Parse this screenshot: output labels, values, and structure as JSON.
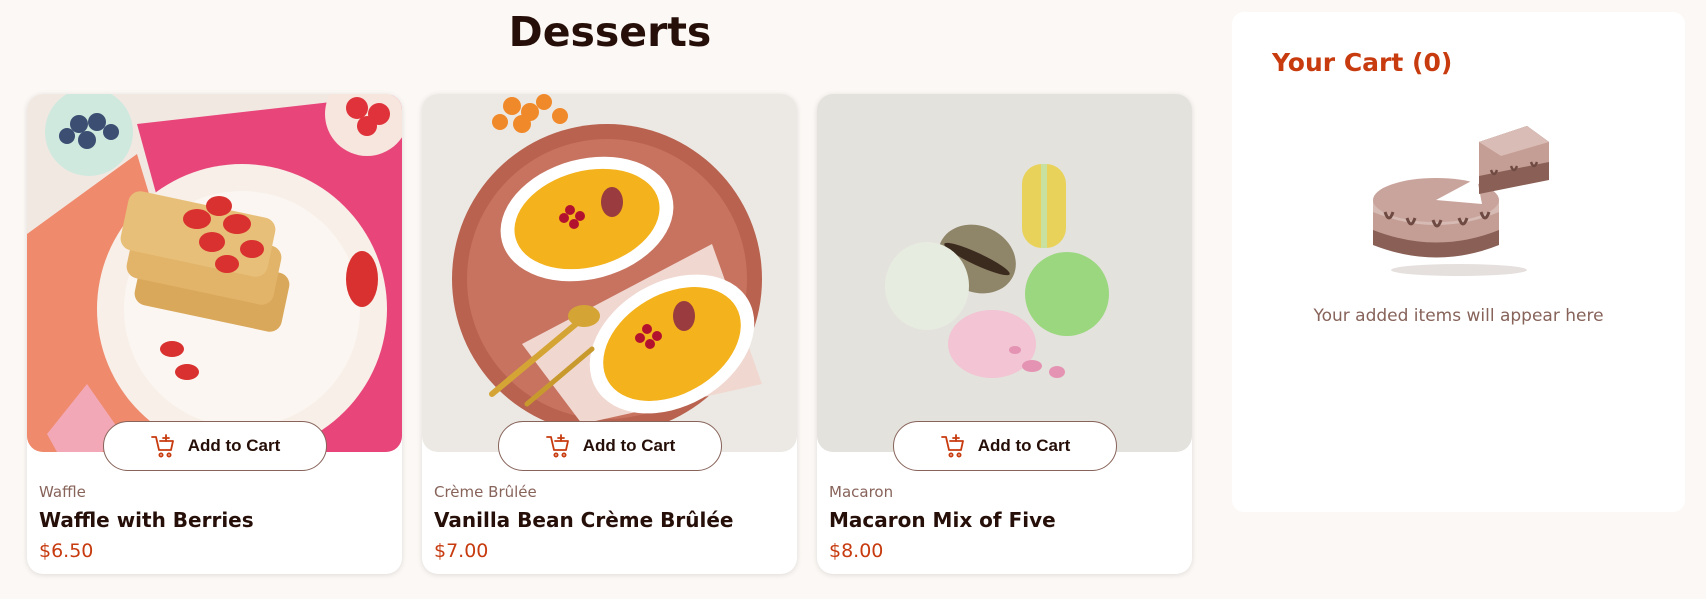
{
  "page": {
    "title": "Desserts"
  },
  "products": [
    {
      "category": "Waffle",
      "name": "Waffle with Berries",
      "price": "$6.50",
      "button_label": "Add to Cart"
    },
    {
      "category": "Crème Brûlée",
      "name": "Vanilla Bean Crème Brûlée",
      "price": "$7.00",
      "button_label": "Add to Cart"
    },
    {
      "category": "Macaron",
      "name": "Macaron Mix of Five",
      "price": "$8.00",
      "button_label": "Add to Cart"
    }
  ],
  "cart": {
    "title": "Your Cart (0)",
    "empty_message": "Your added items will appear here"
  },
  "icons": {
    "add_to_cart": "cart-plus-icon",
    "empty_cart": "cake-illustration"
  },
  "colors": {
    "accent": "#c73b0f",
    "text": "#260f08",
    "muted": "#87635a",
    "background": "#fcf8f5"
  }
}
